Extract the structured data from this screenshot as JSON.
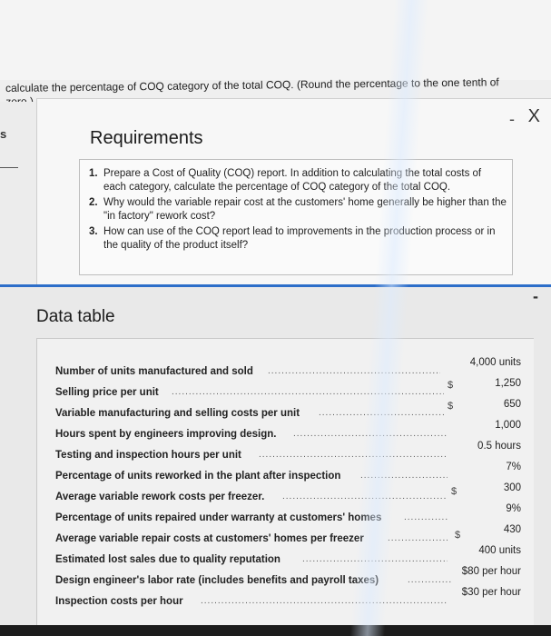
{
  "question": {
    "text": "calculate the percentage of COQ category of the total COQ. (Round the percentage to the one tenth of zero.)"
  },
  "left_stub": {
    "letter": "s"
  },
  "requirements_modal": {
    "title": "Requirements",
    "minimize_glyph": "-",
    "close_glyph": "X",
    "items": [
      {
        "num": "1.",
        "text": "Prepare a Cost of Quality (COQ) report. In addition to calculating the total costs of each category, calculate the percentage of COQ category of the total COQ."
      },
      {
        "num": "2.",
        "text": "Why would the variable repair cost at the customers' home generally be higher than the \"in factory\" rework cost?"
      },
      {
        "num": "3.",
        "text": "How can use of the COQ report lead to improvements in the production process or in the quality of the product itself?"
      }
    ]
  },
  "data_table": {
    "title": "Data table",
    "collapse_glyph": "-",
    "rows": [
      {
        "label": "Number of units manufactured and sold",
        "dollar": "",
        "value": "4,000 units"
      },
      {
        "label": "Selling price per unit",
        "dollar": "$",
        "value": "1,250"
      },
      {
        "label": "Variable manufacturing and selling costs per unit",
        "dollar": "$",
        "value": "650"
      },
      {
        "label": "Hours spent by engineers improving design.",
        "dollar": "",
        "value": "1,000"
      },
      {
        "label": "Testing and inspection hours per unit",
        "dollar": "",
        "value": "0.5 hours"
      },
      {
        "label": "Percentage of units reworked in the plant after inspection",
        "dollar": "",
        "value": "7%"
      },
      {
        "label": "Average variable rework costs per freezer.",
        "dollar": "$",
        "value": "300"
      },
      {
        "label": "Percentage of units repaired under warranty at customers' homes",
        "dollar": "",
        "value": "9%"
      },
      {
        "label": "Average variable repair costs at customers' homes per freezer",
        "dollar": "$",
        "value": "430"
      },
      {
        "label": "Estimated lost sales due to quality reputation",
        "dollar": "",
        "value": "400 units"
      },
      {
        "label": "Design engineer's labor rate (includes benefits and payroll taxes)",
        "dollar": "",
        "value": "$80 per hour"
      },
      {
        "label": "Inspection costs per hour",
        "dollar": "",
        "value": "$30 per hour"
      }
    ]
  }
}
